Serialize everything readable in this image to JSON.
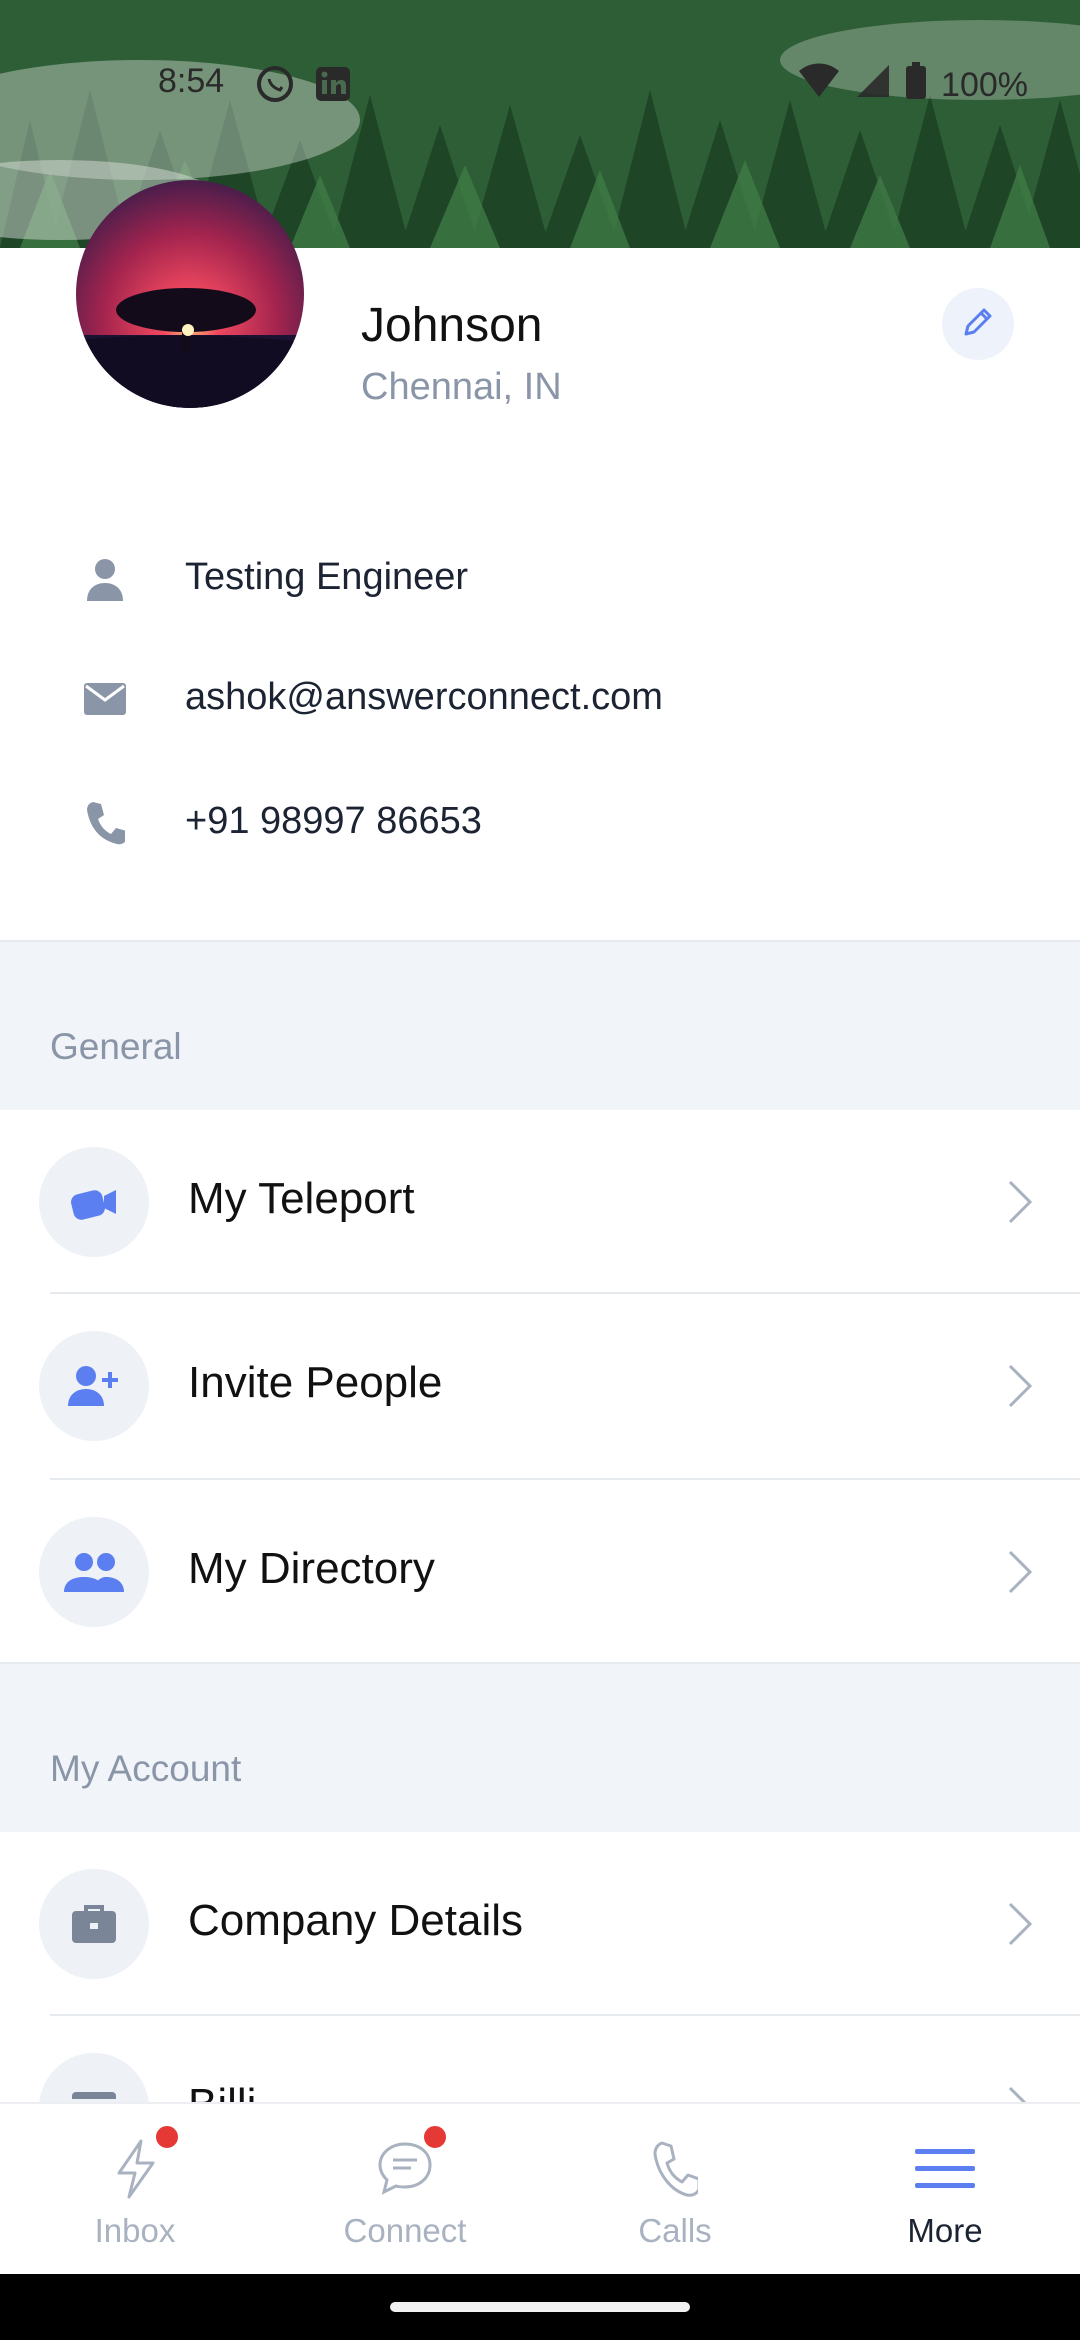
{
  "status_bar": {
    "time": "8:54",
    "battery": "100%"
  },
  "profile": {
    "name": "Johnson",
    "location": "Chennai, IN"
  },
  "info": [
    {
      "icon": "person-icon",
      "text": "Testing Engineer"
    },
    {
      "icon": "email-icon",
      "text": "ashok@answerconnect.com"
    },
    {
      "icon": "phone-icon",
      "text": "+91 98997 86653"
    }
  ],
  "sections": {
    "general": {
      "title": "General",
      "items": [
        {
          "label": "My Teleport",
          "icon": "teleport-icon"
        },
        {
          "label": "Invite People",
          "icon": "add-person-icon"
        },
        {
          "label": "My Directory",
          "icon": "people-icon"
        }
      ]
    },
    "my_account": {
      "title": "My Account",
      "items": [
        {
          "label": "Company Details",
          "icon": "briefcase-icon"
        },
        {
          "label": "Billi",
          "icon": "card-icon"
        }
      ]
    }
  },
  "tabs": [
    {
      "label": "Inbox",
      "icon": "lightning-icon",
      "badge": true
    },
    {
      "label": "Connect",
      "icon": "chat-icon",
      "badge": true
    },
    {
      "label": "Calls",
      "icon": "phone-icon",
      "badge": false
    },
    {
      "label": "More",
      "icon": "menu-icon",
      "badge": false,
      "active": true
    }
  ],
  "colors": {
    "accent": "#5b7ff0",
    "muted": "#8a96a8",
    "section_bg": "#f1f4f9",
    "badge": "#e53935"
  }
}
